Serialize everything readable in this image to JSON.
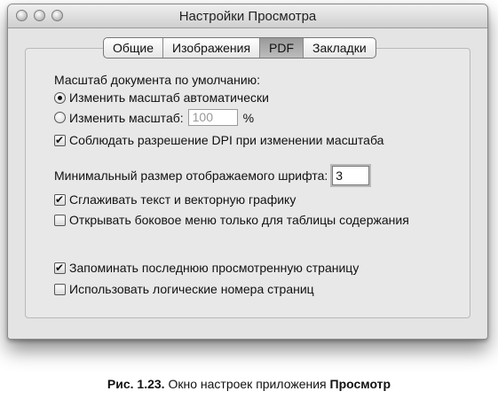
{
  "window": {
    "title": "Настройки Просмотра"
  },
  "tabs": [
    {
      "label": "Общие",
      "active": false
    },
    {
      "label": "Изображения",
      "active": false
    },
    {
      "label": "PDF",
      "active": true
    },
    {
      "label": "Закладки",
      "active": false
    }
  ],
  "pdf": {
    "scale_header": "Масштаб документа по умолчанию:",
    "radio_auto": {
      "label": "Изменить масштаб автоматически",
      "selected": true
    },
    "radio_manual": {
      "label": "Изменить масштаб:",
      "selected": false,
      "value": "100",
      "unit": "%"
    },
    "dpi_check": {
      "label": "Соблюдать разрешение DPI при изменении масштаба",
      "checked": true
    },
    "min_font_label": "Минимальный размер отображаемого шрифта:",
    "min_font_value": "3",
    "smooth_check": {
      "label": "Сглаживать текст и векторную графику",
      "checked": true
    },
    "sidebar_check": {
      "label": "Открывать боковое меню только для таблицы содержания",
      "checked": false
    },
    "remember_check": {
      "label": "Запоминать последнюю просмотренную страницу",
      "checked": true
    },
    "logical_check": {
      "label": "Использовать логические номера страниц",
      "checked": false
    }
  },
  "caption": {
    "prefix": "Рис. 1.23.",
    "text": " Окно настроек приложения ",
    "app": "Просмотр"
  }
}
